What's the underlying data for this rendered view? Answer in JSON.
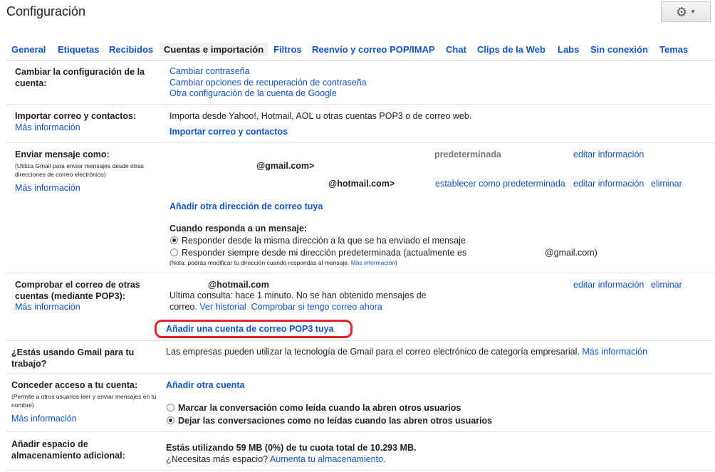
{
  "header": {
    "title": "Configuración",
    "settings_icon": "gear-icon"
  },
  "tabs": [
    {
      "label": "General"
    },
    {
      "label": "Etiquetas"
    },
    {
      "label": "Recibidos"
    },
    {
      "label": "Cuentas e importación",
      "active": true
    },
    {
      "label": "Filtros"
    },
    {
      "label": "Reenvío y correo POP/IMAP"
    },
    {
      "label": "Chat"
    },
    {
      "label": "Clips de la Web"
    },
    {
      "label": "Labs"
    },
    {
      "label": "Sin conexión"
    },
    {
      "label": "Temas"
    }
  ],
  "account": {
    "label": "Cambiar la configuración de la cuenta:",
    "links": [
      "Cambiar contraseña",
      "Cambiar opciones de recuperación de contraseña",
      "Otra configuración de la cuenta de Google"
    ]
  },
  "import": {
    "label": "Importar correo y contactos:",
    "more": "Más información",
    "description": "Importa desde Yahoo!, Hotmail, AOL u otras cuentas POP3 o de correo web.",
    "action": "Importar correo y contactos"
  },
  "send_as": {
    "label": "Enviar mensaje como:",
    "note": "(Utiliza Gmail para enviar mensajes desde otras direcciones de correo electrónico)",
    "more": "Más información",
    "address1": "@gmail.com>",
    "default_label": "predeterminada",
    "edit1": "editar información",
    "address2": "@hotmail.com>",
    "set_default": "establecer como predeterminada",
    "edit2": "editar información",
    "delete2": "eliminar",
    "add": "Añadir otra dirección de correo tuya",
    "reply_title": "Cuando responda a un mensaje:",
    "reply_option1": "Responder desde la misma dirección a la que se ha enviado el mensaje",
    "reply_option2": "Responder siempre desde mi dirección predeterminada (actualmente es",
    "reply_option2_addr": "@gmail.com)",
    "reply_note": "(Nota: podrás modificar tu dirección cuando respondas al mensaje.",
    "reply_note_more": "Más información",
    "reply_note_end": ")"
  },
  "pop3": {
    "label": "Comprobar el correo de otras cuentas (mediante POP3):",
    "more": "Más información",
    "address": "@hotmail.com",
    "status": "Ultima consulta: hace 1 minuto. No se han obtenido mensajes de",
    "status2": "correo.",
    "history": "Ver historial",
    "check_now": "Comprobar si tengo correo ahora",
    "edit": "editar información",
    "delete": "eliminar",
    "add": "Añadir una cuenta de correo POP3 tuya"
  },
  "business": {
    "label": "¿Estás usando Gmail para tu trabajo?",
    "description": "Las empresas pueden utilizar la tecnología de Gmail para el correo electrónico de categoría empresarial.",
    "more": "Más información"
  },
  "grant": {
    "label": "Conceder acceso a tu cuenta:",
    "note": "(Permite a otros usuarios leer y enviar mensajes en tu nombre)",
    "more": "Más información",
    "add": "Añadir otra cuenta",
    "option1": "Marcar la conversación como leída cuando la abren otros usuarios",
    "option2": "Dejar las conversaciones como no leídas cuando las abren otros usuarios"
  },
  "storage": {
    "label": "Añadir espacio de almacenamiento adicional:",
    "usage": "Estás utilizando 59 MB (0%) de tu cuota total de 10.293 MB.",
    "need_more": "¿Necesitas más espacio?",
    "upgrade": "Aumenta tu almacenamiento."
  }
}
